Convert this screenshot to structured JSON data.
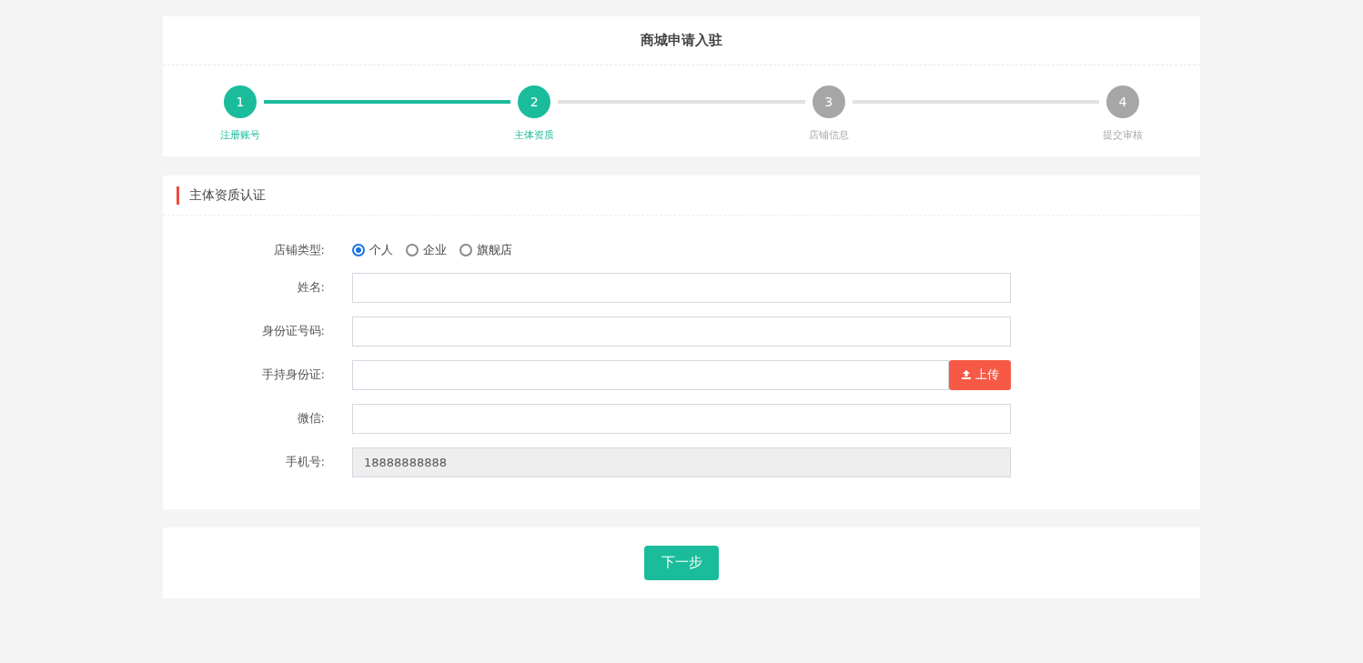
{
  "page_title": "商城申请入驻",
  "steps": [
    {
      "number": "1",
      "label": "注册账号",
      "done": true
    },
    {
      "number": "2",
      "label": "主体资质",
      "done": true
    },
    {
      "number": "3",
      "label": "店铺信息",
      "done": false
    },
    {
      "number": "4",
      "label": "提交审核",
      "done": false
    }
  ],
  "section_title": "主体资质认证",
  "store_type": {
    "label": "店铺类型:",
    "options": [
      {
        "label": "个人",
        "selected": true
      },
      {
        "label": "企业",
        "selected": false
      },
      {
        "label": "旗舰店",
        "selected": false
      }
    ]
  },
  "fields": [
    {
      "kind": "text",
      "label": "姓名:"
    },
    {
      "kind": "text",
      "label": "身份证号码:"
    },
    {
      "kind": "upload",
      "label": "手持身份证:",
      "button": "上传"
    },
    {
      "kind": "text",
      "label": "微信:"
    },
    {
      "kind": "readonly",
      "label": "手机号:",
      "value": "18888888888"
    }
  ],
  "next_button": "下一步"
}
